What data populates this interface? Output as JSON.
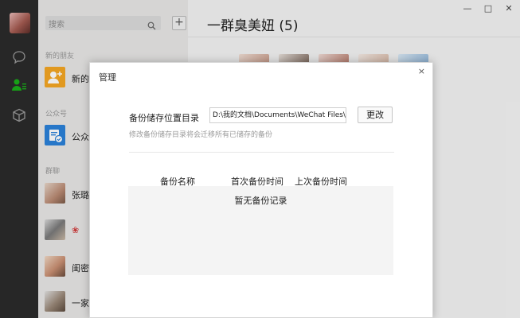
{
  "search": {
    "placeholder": "搜索"
  },
  "list": {
    "section_friends": "新的朋友",
    "section_official": "公众号",
    "section_groups": "群聊",
    "rows": [
      {
        "name": "新的"
      },
      {
        "name": "公众"
      },
      {
        "name": "张璐"
      },
      {
        "name": ""
      },
      {
        "name": "闺密"
      },
      {
        "name": "一家"
      }
    ]
  },
  "chat": {
    "title": "一群臭美妞 (5)"
  },
  "window": {
    "min": "—",
    "max": "□",
    "close": "✕"
  },
  "dialog": {
    "title": "管理",
    "close": "×",
    "storage_label": "备份储存位置目录",
    "path_value": "D:\\我的文档\\Documents\\WeChat Files\\",
    "change_button": "更改",
    "hint": "修改备份储存目录将会迁移所有已储存的备份",
    "columns": [
      "备份名称",
      "首次备份时间",
      "上次备份时间"
    ],
    "empty_text": "暂无备份记录"
  },
  "icons": {
    "chat": "chat-bubble-icon",
    "contacts": "contacts-icon",
    "favorites": "cube-icon",
    "search": "search-icon",
    "add": "plus-icon"
  },
  "colors": {
    "sidebar_bg": "#2b2b2b",
    "list_bg": "#e9e8e7",
    "accent_green": "#1aad19"
  }
}
